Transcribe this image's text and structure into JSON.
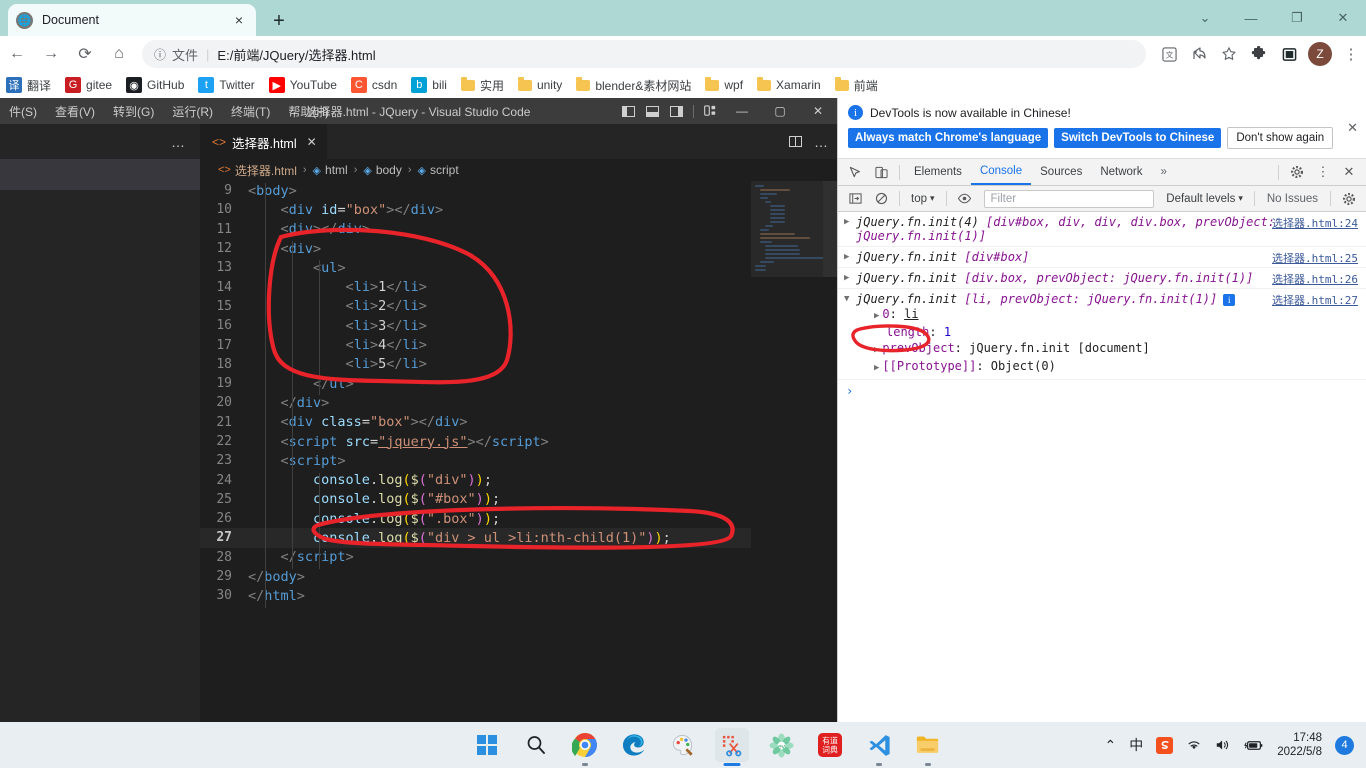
{
  "browser": {
    "tab": {
      "title": "Document",
      "favicon": "globe-icon",
      "close": "×"
    },
    "new_tab": "+",
    "window_controls": {
      "minimize_group": "⌄",
      "minimize": "—",
      "maximize": "❐",
      "close": "✕"
    },
    "nav": {
      "back": "←",
      "forward": "→",
      "reload": "⟳",
      "home": "⌂"
    },
    "omnibox": {
      "info_icon": "ⓘ",
      "scheme_label": "文件",
      "separator": "|",
      "url": "E:/前端/JQuery/选择器.html"
    },
    "toolbar_icons": [
      "translate-icon",
      "share-icon",
      "bookmark-star-icon",
      "extensions-puzzle-icon",
      "sidebar-icon"
    ],
    "profile_initial": "Z",
    "menu_icon": "⋮",
    "bookmarks": [
      {
        "label": "翻译",
        "icon_type": "glyph",
        "glyph": "译",
        "color": "#2c6fbb"
      },
      {
        "label": "gitee",
        "icon_type": "glyph",
        "glyph": "G",
        "color": "#c71d23"
      },
      {
        "label": "GitHub",
        "icon_type": "glyph",
        "glyph": "◉",
        "color": "#1b1f23"
      },
      {
        "label": "Twitter",
        "icon_type": "glyph",
        "glyph": "t",
        "color": "#1da1f2"
      },
      {
        "label": "YouTube",
        "icon_type": "glyph",
        "glyph": "▶",
        "color": "#ff0000"
      },
      {
        "label": "csdn",
        "icon_type": "glyph",
        "glyph": "C",
        "color": "#fc5531"
      },
      {
        "label": "bili",
        "icon_type": "glyph",
        "glyph": "b",
        "color": "#00a1d6"
      },
      {
        "label": "实用",
        "icon_type": "folder"
      },
      {
        "label": "unity",
        "icon_type": "folder"
      },
      {
        "label": "blender&素材网站",
        "icon_type": "folder"
      },
      {
        "label": "wpf",
        "icon_type": "folder"
      },
      {
        "label": "Xamarin",
        "icon_type": "folder"
      },
      {
        "label": "前端",
        "icon_type": "folder"
      }
    ]
  },
  "vscode": {
    "window_title": "选择器.html - JQuery - Visual Studio Code",
    "menu": [
      "件(S)",
      "查看(V)",
      "转到(G)",
      "运行(R)",
      "终端(T)",
      "帮助(H)"
    ],
    "layout_icons": [
      "toggle-primary-sidebar-icon",
      "toggle-panel-icon",
      "toggle-secondary-sidebar-icon",
      "customize-layout-icon"
    ],
    "win_controls": {
      "minimize": "—",
      "maximize": "▢",
      "close": "✕"
    },
    "sidebar_more": "…",
    "tab": {
      "label": "选择器.html",
      "icon": "html-file-icon",
      "close": "✕"
    },
    "editor_actions": {
      "split": "split-editor-icon",
      "more": "…"
    },
    "breadcrumb": [
      {
        "label": "选择器.html",
        "icon": "html-file-icon"
      },
      {
        "label": "html",
        "icon": "symbol-icon"
      },
      {
        "label": "body",
        "icon": "symbol-icon"
      },
      {
        "label": "script",
        "icon": "symbol-icon"
      }
    ],
    "breadcrumb_sep": "›",
    "active_line": 27,
    "code_lines": [
      {
        "n": 9,
        "indent": 0,
        "tokens": [
          {
            "t": "tagbr",
            "v": "<"
          },
          {
            "t": "tag",
            "v": "body"
          },
          {
            "t": "tagbr",
            "v": ">"
          }
        ]
      },
      {
        "n": 10,
        "indent": 1,
        "tokens": [
          {
            "t": "tagbr",
            "v": "<"
          },
          {
            "t": "tag",
            "v": "div "
          },
          {
            "t": "attr",
            "v": "id"
          },
          {
            "t": "plain",
            "v": "="
          },
          {
            "t": "str",
            "v": "\"box\""
          },
          {
            "t": "tagbr",
            "v": "></"
          },
          {
            "t": "tag",
            "v": "div"
          },
          {
            "t": "tagbr",
            "v": ">"
          }
        ]
      },
      {
        "n": 11,
        "indent": 1,
        "tokens": [
          {
            "t": "tagbr",
            "v": "<"
          },
          {
            "t": "tag",
            "v": "div"
          },
          {
            "t": "tagbr",
            "v": "></"
          },
          {
            "t": "tag",
            "v": "div"
          },
          {
            "t": "tagbr",
            "v": ">"
          }
        ]
      },
      {
        "n": 12,
        "indent": 1,
        "tokens": [
          {
            "t": "tagbr",
            "v": "<"
          },
          {
            "t": "tag",
            "v": "div"
          },
          {
            "t": "tagbr",
            "v": ">"
          }
        ]
      },
      {
        "n": 13,
        "indent": 2,
        "tokens": [
          {
            "t": "tagbr",
            "v": "<"
          },
          {
            "t": "tag",
            "v": "ul"
          },
          {
            "t": "tagbr",
            "v": ">"
          }
        ]
      },
      {
        "n": 14,
        "indent": 3,
        "tokens": [
          {
            "t": "tagbr",
            "v": "<"
          },
          {
            "t": "tag",
            "v": "li"
          },
          {
            "t": "tagbr",
            "v": ">"
          },
          {
            "t": "txtnum",
            "v": "1"
          },
          {
            "t": "tagbr",
            "v": "</"
          },
          {
            "t": "tag",
            "v": "li"
          },
          {
            "t": "tagbr",
            "v": ">"
          }
        ]
      },
      {
        "n": 15,
        "indent": 3,
        "tokens": [
          {
            "t": "tagbr",
            "v": "<"
          },
          {
            "t": "tag",
            "v": "li"
          },
          {
            "t": "tagbr",
            "v": ">"
          },
          {
            "t": "txtnum",
            "v": "2"
          },
          {
            "t": "tagbr",
            "v": "</"
          },
          {
            "t": "tag",
            "v": "li"
          },
          {
            "t": "tagbr",
            "v": ">"
          }
        ]
      },
      {
        "n": 16,
        "indent": 3,
        "tokens": [
          {
            "t": "tagbr",
            "v": "<"
          },
          {
            "t": "tag",
            "v": "li"
          },
          {
            "t": "tagbr",
            "v": ">"
          },
          {
            "t": "txtnum",
            "v": "3"
          },
          {
            "t": "tagbr",
            "v": "</"
          },
          {
            "t": "tag",
            "v": "li"
          },
          {
            "t": "tagbr",
            "v": ">"
          }
        ]
      },
      {
        "n": 17,
        "indent": 3,
        "tokens": [
          {
            "t": "tagbr",
            "v": "<"
          },
          {
            "t": "tag",
            "v": "li"
          },
          {
            "t": "tagbr",
            "v": ">"
          },
          {
            "t": "txtnum",
            "v": "4"
          },
          {
            "t": "tagbr",
            "v": "</"
          },
          {
            "t": "tag",
            "v": "li"
          },
          {
            "t": "tagbr",
            "v": ">"
          }
        ]
      },
      {
        "n": 18,
        "indent": 3,
        "tokens": [
          {
            "t": "tagbr",
            "v": "<"
          },
          {
            "t": "tag",
            "v": "li"
          },
          {
            "t": "tagbr",
            "v": ">"
          },
          {
            "t": "txtnum",
            "v": "5"
          },
          {
            "t": "tagbr",
            "v": "</"
          },
          {
            "t": "tag",
            "v": "li"
          },
          {
            "t": "tagbr",
            "v": ">"
          }
        ]
      },
      {
        "n": 19,
        "indent": 2,
        "tokens": [
          {
            "t": "tagbr",
            "v": "</"
          },
          {
            "t": "tag",
            "v": "ul"
          },
          {
            "t": "tagbr",
            "v": ">"
          }
        ]
      },
      {
        "n": 20,
        "indent": 1,
        "tokens": [
          {
            "t": "tagbr",
            "v": "</"
          },
          {
            "t": "tag",
            "v": "div"
          },
          {
            "t": "tagbr",
            "v": ">"
          }
        ]
      },
      {
        "n": 21,
        "indent": 1,
        "tokens": [
          {
            "t": "tagbr",
            "v": "<"
          },
          {
            "t": "tag",
            "v": "div "
          },
          {
            "t": "attr",
            "v": "class"
          },
          {
            "t": "plain",
            "v": "="
          },
          {
            "t": "str",
            "v": "\"box\""
          },
          {
            "t": "tagbr",
            "v": "></"
          },
          {
            "t": "tag",
            "v": "div"
          },
          {
            "t": "tagbr",
            "v": ">"
          }
        ]
      },
      {
        "n": 22,
        "indent": 1,
        "tokens": [
          {
            "t": "tagbr",
            "v": "<"
          },
          {
            "t": "tag",
            "v": "script "
          },
          {
            "t": "attr",
            "v": "src"
          },
          {
            "t": "plain",
            "v": "="
          },
          {
            "t": "str link",
            "v": "\"jquery.js\""
          },
          {
            "t": "tagbr",
            "v": "></"
          },
          {
            "t": "tag",
            "v": "script"
          },
          {
            "t": "tagbr",
            "v": ">"
          }
        ]
      },
      {
        "n": 23,
        "indent": 1,
        "tokens": [
          {
            "t": "tagbr",
            "v": "<"
          },
          {
            "t": "tag",
            "v": "script"
          },
          {
            "t": "tagbr",
            "v": ">"
          }
        ]
      },
      {
        "n": 24,
        "indent": 2,
        "tokens": [
          {
            "t": "var",
            "v": "console"
          },
          {
            "t": "plain",
            "v": "."
          },
          {
            "t": "fn",
            "v": "log"
          },
          {
            "t": "paren1",
            "v": "("
          },
          {
            "t": "fn",
            "v": "$"
          },
          {
            "t": "paren2",
            "v": "("
          },
          {
            "t": "str",
            "v": "\"div\""
          },
          {
            "t": "paren2",
            "v": ")"
          },
          {
            "t": "paren1",
            "v": ")"
          },
          {
            "t": "plain",
            "v": ";"
          }
        ]
      },
      {
        "n": 25,
        "indent": 2,
        "tokens": [
          {
            "t": "var",
            "v": "console"
          },
          {
            "t": "plain",
            "v": "."
          },
          {
            "t": "fn",
            "v": "log"
          },
          {
            "t": "paren1",
            "v": "("
          },
          {
            "t": "fn",
            "v": "$"
          },
          {
            "t": "paren2",
            "v": "("
          },
          {
            "t": "str",
            "v": "\"#box\""
          },
          {
            "t": "paren2",
            "v": ")"
          },
          {
            "t": "paren1",
            "v": ")"
          },
          {
            "t": "plain",
            "v": ";"
          }
        ]
      },
      {
        "n": 26,
        "indent": 2,
        "tokens": [
          {
            "t": "var",
            "v": "console"
          },
          {
            "t": "plain",
            "v": "."
          },
          {
            "t": "fn",
            "v": "log"
          },
          {
            "t": "paren1",
            "v": "("
          },
          {
            "t": "fn",
            "v": "$"
          },
          {
            "t": "paren2",
            "v": "("
          },
          {
            "t": "str",
            "v": "\".box\""
          },
          {
            "t": "paren2",
            "v": ")"
          },
          {
            "t": "paren1",
            "v": ")"
          },
          {
            "t": "plain",
            "v": ";"
          }
        ]
      },
      {
        "n": 27,
        "indent": 2,
        "tokens": [
          {
            "t": "var",
            "v": "console"
          },
          {
            "t": "plain",
            "v": "."
          },
          {
            "t": "fn",
            "v": "log"
          },
          {
            "t": "paren1",
            "v": "("
          },
          {
            "t": "fn",
            "v": "$"
          },
          {
            "t": "paren2",
            "v": "("
          },
          {
            "t": "str",
            "v": "\"div > ul >li:nth-child(1)\""
          },
          {
            "t": "paren2",
            "v": ")"
          },
          {
            "t": "paren1",
            "v": ")"
          },
          {
            "t": "plain",
            "v": ";"
          }
        ]
      },
      {
        "n": 28,
        "indent": 1,
        "tokens": [
          {
            "t": "tagbr",
            "v": "</"
          },
          {
            "t": "tag",
            "v": "script"
          },
          {
            "t": "tagbr",
            "v": ">"
          }
        ]
      },
      {
        "n": 29,
        "indent": 0,
        "tokens": [
          {
            "t": "tagbr",
            "v": "</"
          },
          {
            "t": "tag",
            "v": "body"
          },
          {
            "t": "tagbr",
            "v": ">"
          }
        ]
      },
      {
        "n": 30,
        "indent": 0,
        "tokens": [
          {
            "t": "tagbr",
            "v": "</"
          },
          {
            "t": "tag",
            "v": "html"
          },
          {
            "t": "tagbr",
            "v": ">"
          }
        ]
      }
    ]
  },
  "devtools": {
    "banner": {
      "info_icon": "i",
      "message": "DevTools is now available in Chinese!",
      "btn_always": "Always match Chrome's language",
      "btn_switch": "Switch DevTools to Chinese",
      "btn_dismiss": "Don't show again",
      "close": "✕"
    },
    "tabs": [
      {
        "label": "Elements",
        "active": false
      },
      {
        "label": "Console",
        "active": true
      },
      {
        "label": "Sources",
        "active": false
      },
      {
        "label": "Network",
        "active": false
      }
    ],
    "tabs_overflow": "»",
    "tab_icons": {
      "inspect": "inspect-cursor-icon",
      "device": "device-toolbar-icon",
      "settings": "gear-icon",
      "more": "⋮",
      "close": "✕"
    },
    "toolbar": {
      "sidebar_toggle": "console-sidebar-icon",
      "clear": "clear-console-icon",
      "context": "top",
      "context_caret": "▾",
      "eye": "live-expression-icon",
      "filter_placeholder": "Filter",
      "levels": "Default levels",
      "levels_caret": "▾",
      "issues": "No Issues",
      "settings": "gear-icon"
    },
    "messages": [
      {
        "arrow": "▶",
        "source": "选择器.html:24",
        "parts": [
          {
            "cls": "jq",
            "text": "jQuery.fn.init(4) "
          },
          {
            "cls": "jq-brk",
            "text": "[div#box, div, div, div.box, prevObject: jQuery.fn.init(1)]"
          }
        ],
        "children": []
      },
      {
        "arrow": "▶",
        "source": "选择器.html:25",
        "parts": [
          {
            "cls": "jq",
            "text": "jQuery.fn.init "
          },
          {
            "cls": "jq-brk",
            "text": "[div#box]"
          }
        ],
        "children": []
      },
      {
        "arrow": "▶",
        "source": "选择器.html:26",
        "parts": [
          {
            "cls": "jq",
            "text": "jQuery.fn.init "
          },
          {
            "cls": "jq-brk",
            "text": "[div.box, prevObject: jQuery.fn.init(1)]"
          }
        ],
        "children": []
      },
      {
        "arrow": "▼",
        "source": "选择器.html:27",
        "badge": "i",
        "parts": [
          {
            "cls": "jq",
            "text": "jQuery.fn.init "
          },
          {
            "cls": "jq-brk",
            "text": "[li, prevObject: jQuery.fn.init(1)]"
          }
        ],
        "children": [
          {
            "arrow": "▶",
            "name": "0",
            "sep": ": ",
            "value": "li",
            "vcls": "pval underline"
          },
          {
            "arrow": "",
            "name": "length",
            "sep": ": ",
            "value": "1",
            "vcls": "pnum"
          },
          {
            "arrow": "▶",
            "name": "prevObject",
            "sep": ": ",
            "value": "jQuery.fn.init [document]",
            "vcls": "pval"
          },
          {
            "arrow": "▶",
            "name": "[[Prototype]]",
            "sep": ": ",
            "value": "Object(0)",
            "vcls": "pval"
          }
        ]
      }
    ],
    "prompt": "›"
  },
  "taskbar": {
    "items": [
      {
        "name": "start-button",
        "icon": "windows-logo-icon",
        "running": false
      },
      {
        "name": "search-button",
        "icon": "search-icon",
        "running": false
      },
      {
        "name": "chrome-button",
        "icon": "chrome-icon",
        "running": true
      },
      {
        "name": "edge-button",
        "icon": "edge-icon",
        "running": false
      },
      {
        "name": "paint-button",
        "icon": "paint-icon",
        "running": false
      },
      {
        "name": "snipping-tool-button",
        "icon": "snipping-tool-icon",
        "running": true,
        "active": true
      },
      {
        "name": "ev-app-button",
        "icon": "flower-app-icon",
        "running": false
      },
      {
        "name": "youdao-button",
        "icon": "youdao-dict-icon",
        "running": false
      },
      {
        "name": "vscode-button",
        "icon": "vscode-icon",
        "running": true
      },
      {
        "name": "file-explorer-button",
        "icon": "folder-icon",
        "running": true
      }
    ],
    "tray": {
      "chevron": "⌃",
      "ime": "中",
      "sogou": "S",
      "wifi": "wifi-icon",
      "volume": "volume-icon",
      "battery": "battery-icon",
      "time": "17:48",
      "date": "2022/5/8",
      "notification_count": "4"
    }
  },
  "annotations": {
    "color": "#e8232a",
    "shapes": [
      "ellipse-around-ul-list",
      "ellipse-around-line27",
      "ellipse-around-console-0-li"
    ]
  }
}
